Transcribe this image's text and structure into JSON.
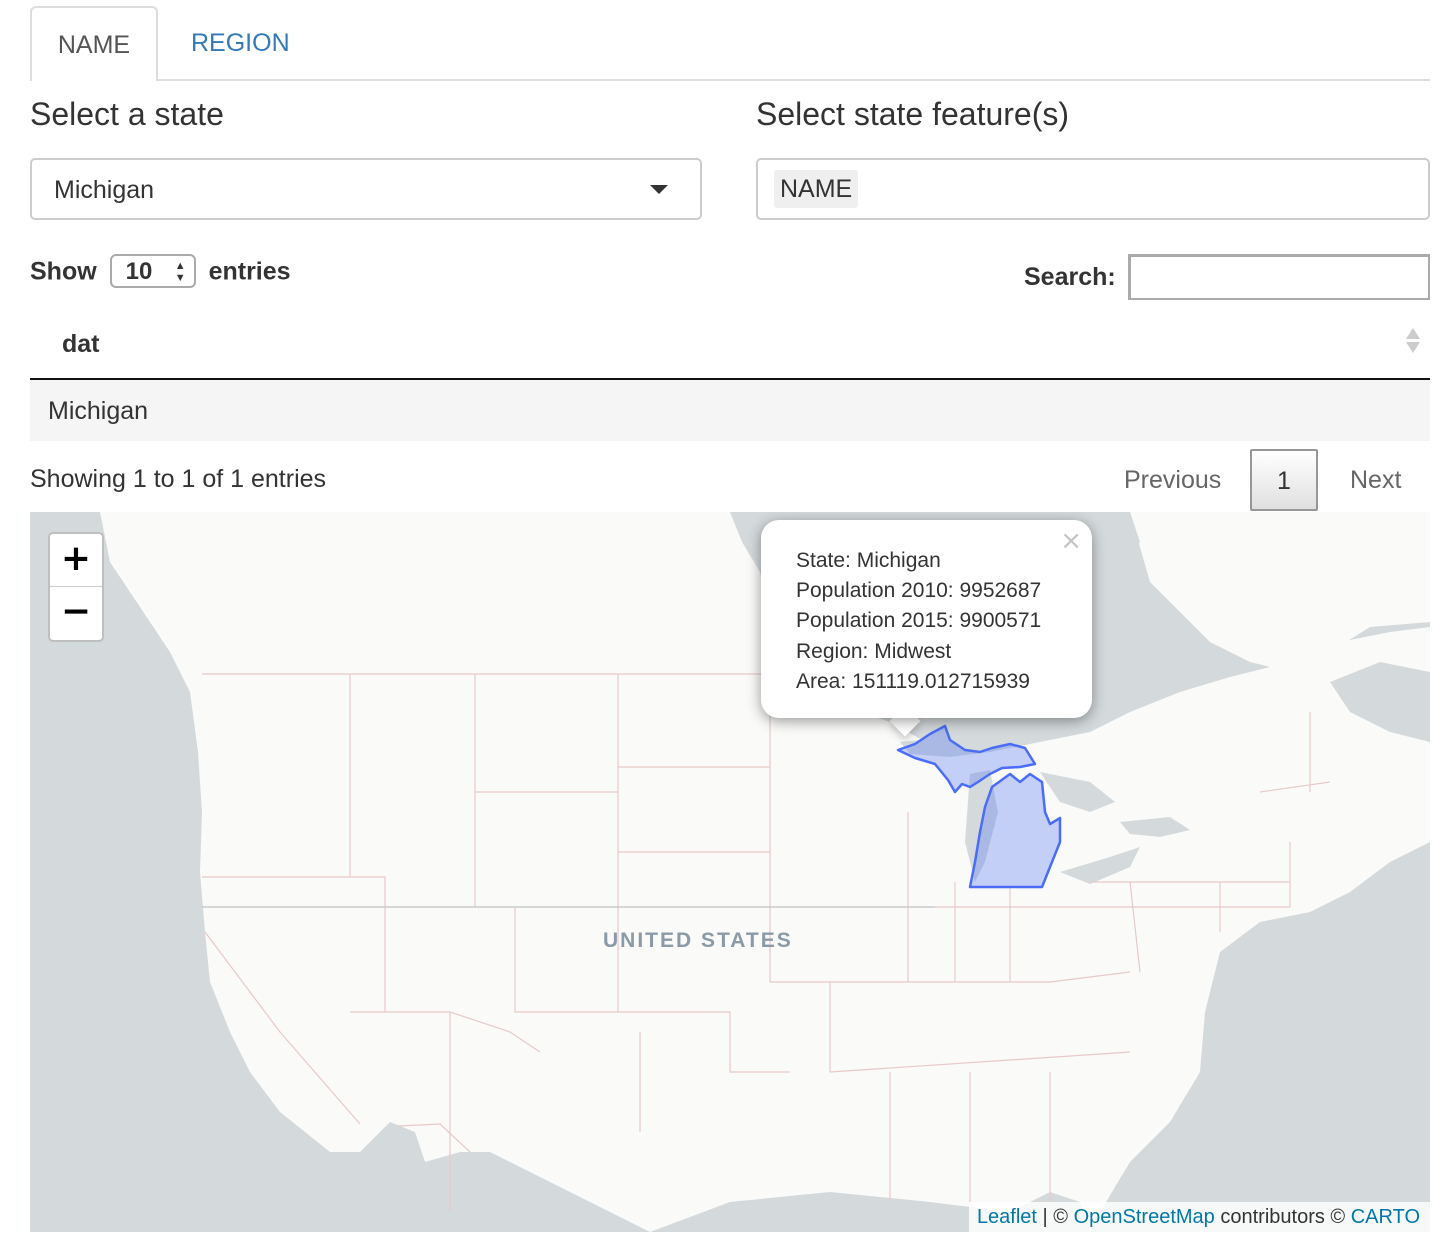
{
  "tabs": [
    {
      "label": "NAME",
      "active": true
    },
    {
      "label": "REGION",
      "active": false
    }
  ],
  "state_select": {
    "label": "Select a state",
    "value": "Michigan"
  },
  "feature_select": {
    "label": "Select state feature(s)",
    "selected": [
      "NAME"
    ]
  },
  "table_controls": {
    "show_label": "Show",
    "length_value": "10",
    "entries_label": "entries",
    "search_label": "Search:",
    "search_value": ""
  },
  "table": {
    "columns": [
      "dat"
    ],
    "rows": [
      [
        "Michigan"
      ]
    ]
  },
  "info": "Showing 1 to 1 of 1 entries",
  "pagination": {
    "previous": "Previous",
    "current": "1",
    "next": "Next"
  },
  "map": {
    "zoom_in": "+",
    "zoom_out": "−",
    "country_label": "UNITED STATES",
    "highlight_color": "#4a6cf7",
    "popup": {
      "close": "×",
      "lines": [
        "State: Michigan",
        "Population 2010: 9952687",
        "Population 2015: 9900571",
        "Region: Midwest",
        "Area: 151119.012715939"
      ]
    },
    "attribution": {
      "leaflet": "Leaflet",
      "sep": " | © ",
      "osm": "OpenStreetMap",
      "contributors": " contributors © ",
      "carto": "CARTO"
    }
  },
  "colors": {
    "link": "#337ab7",
    "water": "#d4dadc",
    "land": "#fafaf8"
  }
}
